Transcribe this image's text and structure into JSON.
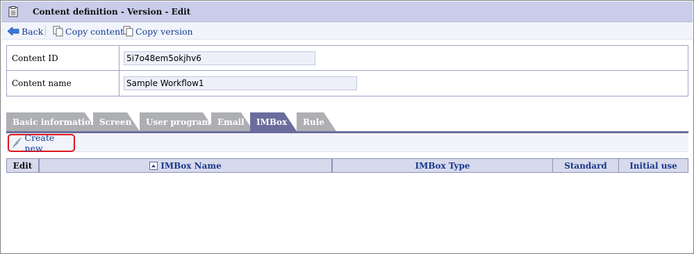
{
  "window": {
    "title": "Content definition - Version - Edit"
  },
  "toolbar": {
    "back_label": "Back",
    "copy_content_label": "Copy content",
    "copy_version_label": "Copy version"
  },
  "info": {
    "content_id_label": "Content ID",
    "content_id_value": "5i7o48em5okjhv6",
    "content_name_label": "Content name",
    "content_name_value": "Sample Workflow1"
  },
  "tabs": [
    {
      "label": "Basic information",
      "active": false
    },
    {
      "label": "Screen",
      "active": false
    },
    {
      "label": "User program",
      "active": false
    },
    {
      "label": "Email",
      "active": false
    },
    {
      "label": "IMBox",
      "active": true
    },
    {
      "label": "Rule",
      "active": false
    }
  ],
  "actions": {
    "create_new_label": "Create new",
    "highlight_color": "#e0141c"
  },
  "grid": {
    "columns": [
      "Edit",
      "IMBox Name",
      "IMBox Type",
      "Standard",
      "Initial use"
    ],
    "sorted_column": "IMBox Name",
    "rows": []
  },
  "colors": {
    "title_bar": "#c9cdea",
    "active_tab": "#6a6d9c",
    "inactive_tab": "#aeafb3",
    "link": "#123c8e",
    "header_text": "#1a3a8c"
  },
  "icons": {
    "title": "document-icon",
    "back": "back-arrow-icon",
    "copy_content": "copy-page-icon",
    "copy_version": "copy-page-icon",
    "create_new": "feather-pen-icon",
    "sort": "sort-ascending-icon"
  }
}
